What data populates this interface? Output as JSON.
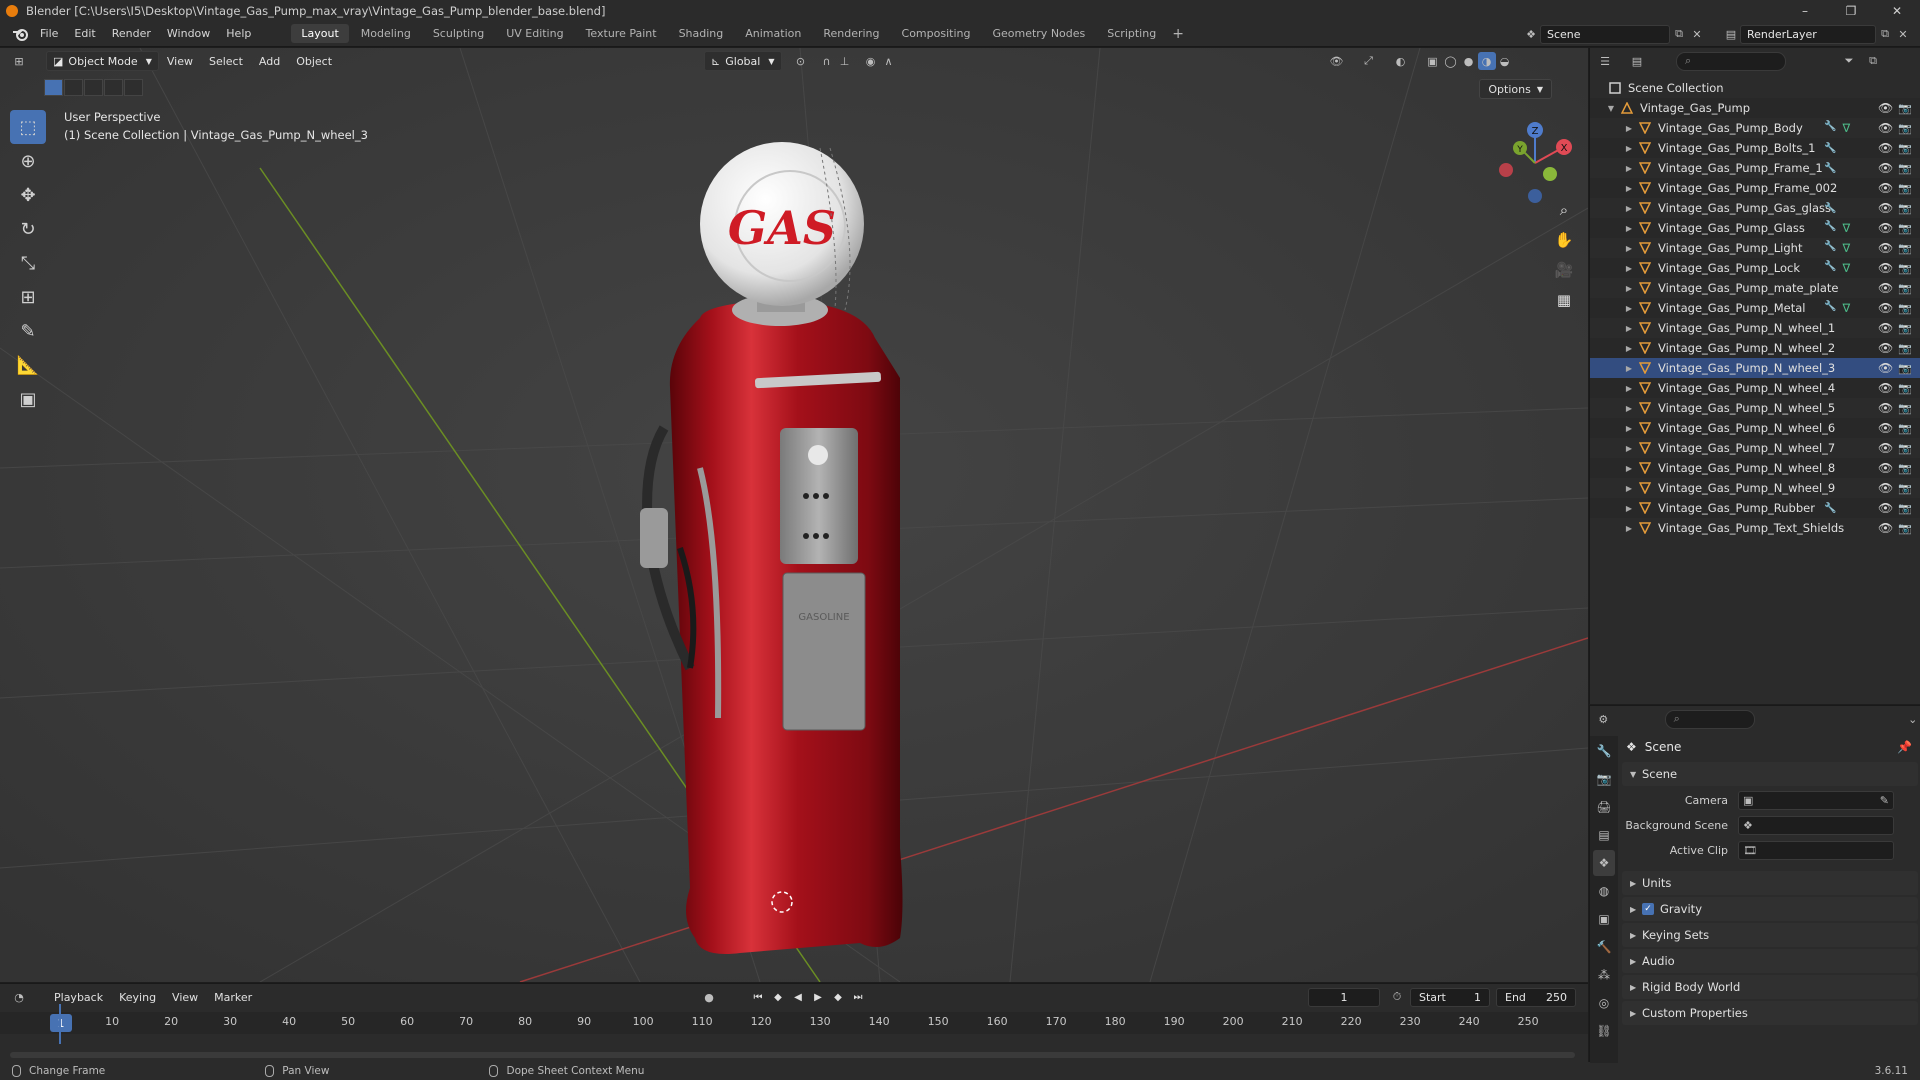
{
  "window": {
    "title": "Blender [C:\\Users\\I5\\Desktop\\Vintage_Gas_Pump_max_vray\\Vintage_Gas_Pump_blender_base.blend]",
    "minimize": "–",
    "maximize": "❐",
    "close": "✕"
  },
  "menu": {
    "items": [
      "File",
      "Edit",
      "Render",
      "Window",
      "Help"
    ],
    "workspaces": [
      "Layout",
      "Modeling",
      "Sculpting",
      "UV Editing",
      "Texture Paint",
      "Shading",
      "Animation",
      "Rendering",
      "Compositing",
      "Geometry Nodes",
      "Scripting"
    ],
    "add_workspace": "+",
    "scene": "Scene",
    "view_layer": "RenderLayer"
  },
  "viewport": {
    "mode": "Object Mode",
    "menus": [
      "View",
      "Select",
      "Add",
      "Object"
    ],
    "transform_orientation": "Global",
    "options": "Options",
    "info_line1": "User Perspective",
    "info_line2": "(1) Scene Collection | Vintage_Gas_Pump_N_wheel_3",
    "gizmo": {
      "z": "Z",
      "y": "Y",
      "x": "X"
    },
    "pump_sign": "GAS",
    "pump_plate": "GASOLINE"
  },
  "timeline": {
    "menus": [
      "Playback",
      "Keying",
      "View",
      "Marker"
    ],
    "current_frame": "1",
    "start_label": "Start",
    "start": "1",
    "end_label": "End",
    "end": "250",
    "ticks": [
      "1",
      "10",
      "20",
      "30",
      "40",
      "50",
      "60",
      "70",
      "80",
      "90",
      "100",
      "110",
      "120",
      "130",
      "140",
      "150",
      "160",
      "170",
      "180",
      "190",
      "200",
      "210",
      "220",
      "230",
      "240",
      "250"
    ]
  },
  "status": {
    "left": "Change Frame",
    "middle": "Pan View",
    "right": "Dope Sheet Context Menu",
    "version": "3.6.11"
  },
  "outliner": {
    "root": "Scene Collection",
    "collection": "Vintage_Gas_Pump",
    "objects": [
      "Vintage_Gas_Pump_Body",
      "Vintage_Gas_Pump_Bolts_1",
      "Vintage_Gas_Pump_Frame_1",
      "Vintage_Gas_Pump_Frame_002",
      "Vintage_Gas_Pump_Gas_glass",
      "Vintage_Gas_Pump_Glass",
      "Vintage_Gas_Pump_Light",
      "Vintage_Gas_Pump_Lock",
      "Vintage_Gas_Pump_mate_plate",
      "Vintage_Gas_Pump_Metal",
      "Vintage_Gas_Pump_N_wheel_1",
      "Vintage_Gas_Pump_N_wheel_2",
      "Vintage_Gas_Pump_N_wheel_3",
      "Vintage_Gas_Pump_N_wheel_4",
      "Vintage_Gas_Pump_N_wheel_5",
      "Vintage_Gas_Pump_N_wheel_6",
      "Vintage_Gas_Pump_N_wheel_7",
      "Vintage_Gas_Pump_N_wheel_8",
      "Vintage_Gas_Pump_N_wheel_9",
      "Vintage_Gas_Pump_Rubber",
      "Vintage_Gas_Pump_Text_Shields"
    ]
  },
  "properties": {
    "context": "Scene",
    "panel_scene": "Scene",
    "camera_label": "Camera",
    "background_label": "Background Scene",
    "clip_label": "Active Clip",
    "panels": [
      "Units",
      "Gravity",
      "Keying Sets",
      "Audio",
      "Rigid Body World",
      "Custom Properties"
    ]
  },
  "colors": {
    "accent": "#4772b3",
    "selected_row": "#334d80",
    "pump_red": "#a4101a"
  }
}
